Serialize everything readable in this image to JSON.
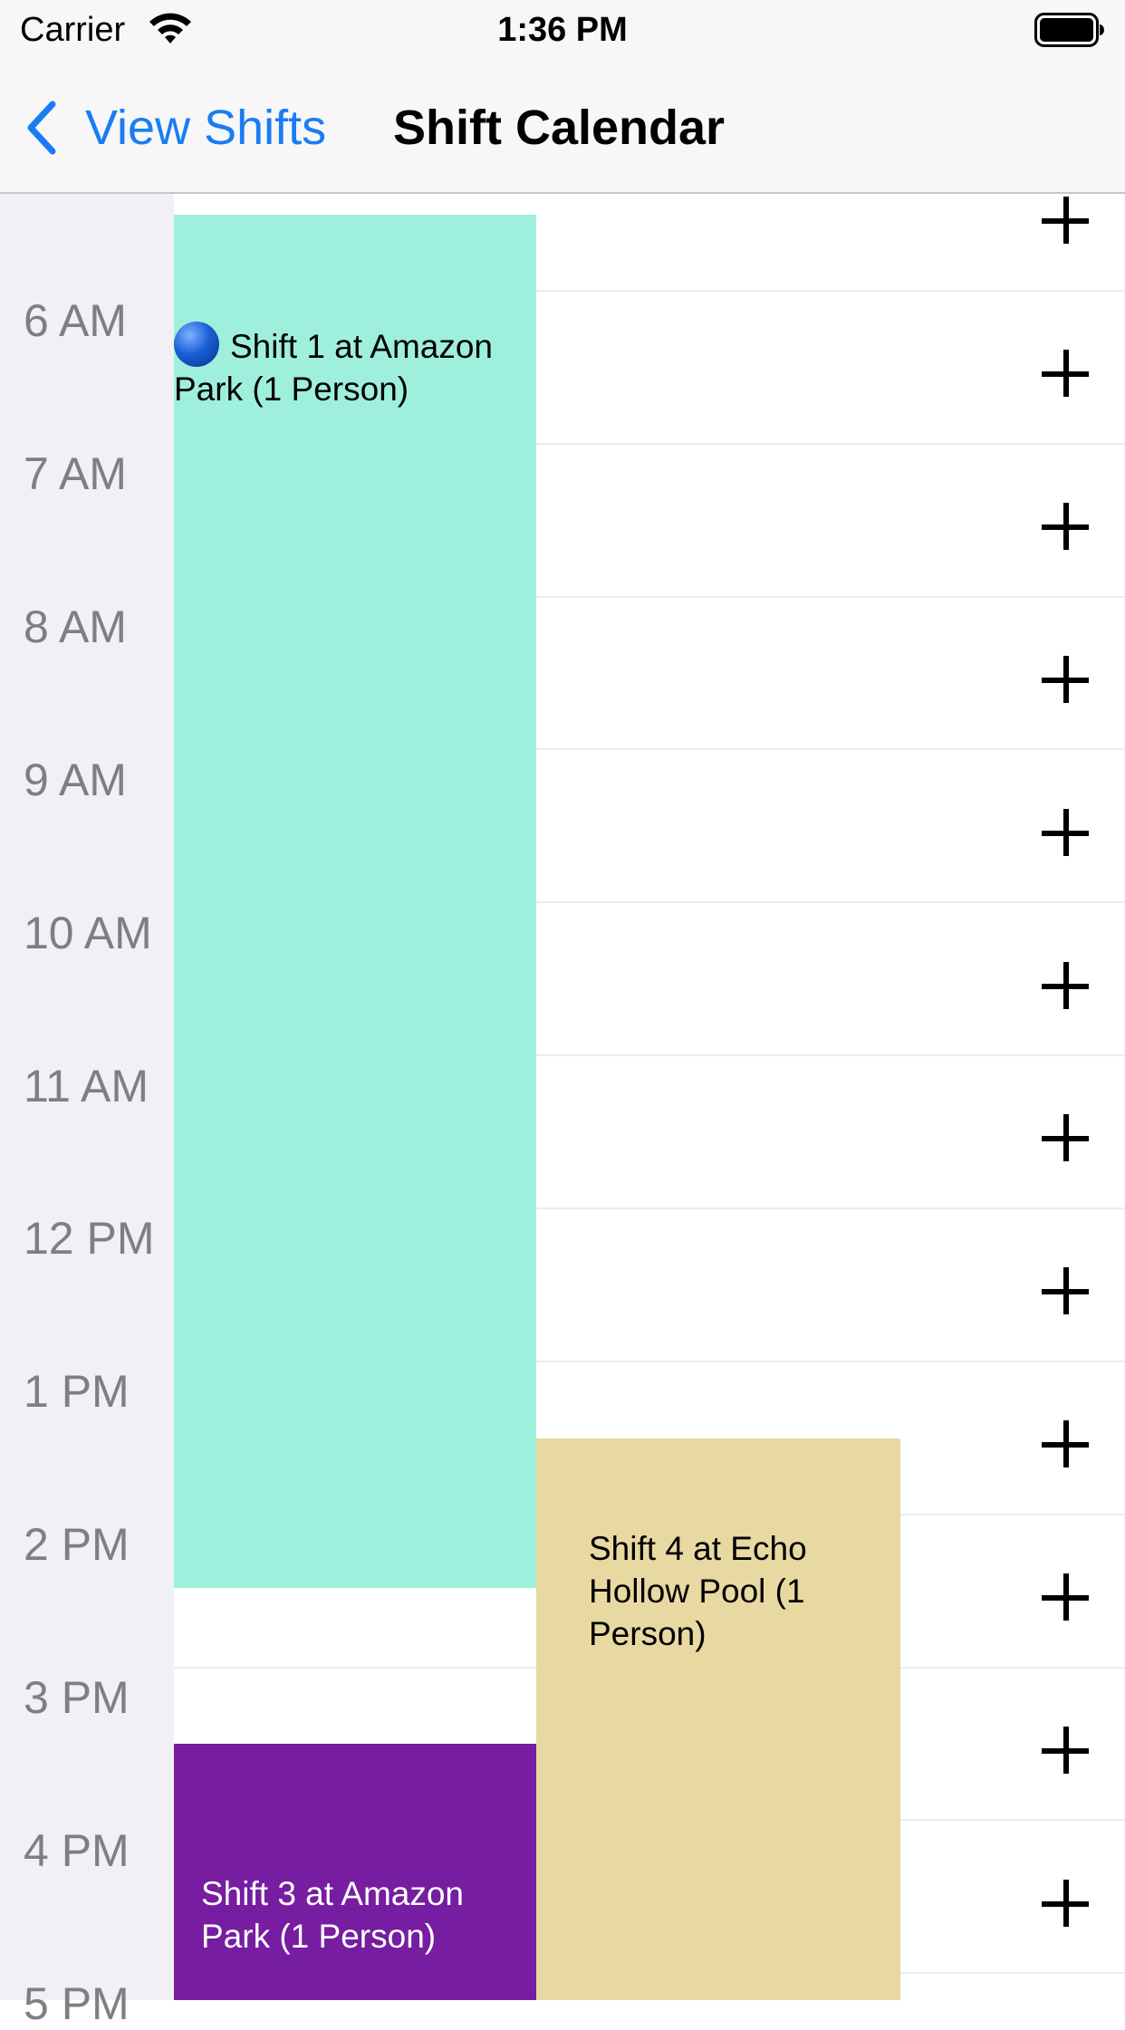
{
  "status_bar": {
    "carrier": "Carrier",
    "time": "1:36 PM"
  },
  "nav": {
    "back_label": "View Shifts",
    "title": "Shift Calendar"
  },
  "hours": [
    "6 AM",
    "7 AM",
    "8 AM",
    "9 AM",
    "10 AM",
    "11 AM",
    "12 PM",
    "1 PM",
    "2 PM",
    "3 PM",
    "4 PM",
    "5 PM"
  ],
  "events": {
    "shift1": {
      "icon": "blue-circle-icon",
      "title": "Shift 1 at Amazon Park (1 Person)",
      "color": "#9fefdd"
    },
    "shift4": {
      "title": "Shift 4 at Echo Hollow Pool (1 Person)",
      "color": "#e8d8a2"
    },
    "shift3": {
      "title": "Shift 3 at Amazon Park (1 Person)",
      "color": "#761da1"
    }
  },
  "colors": {
    "accent": "#1a7cf5",
    "gutter": "#f1f1f5",
    "hour_text": "#7e7e84"
  }
}
